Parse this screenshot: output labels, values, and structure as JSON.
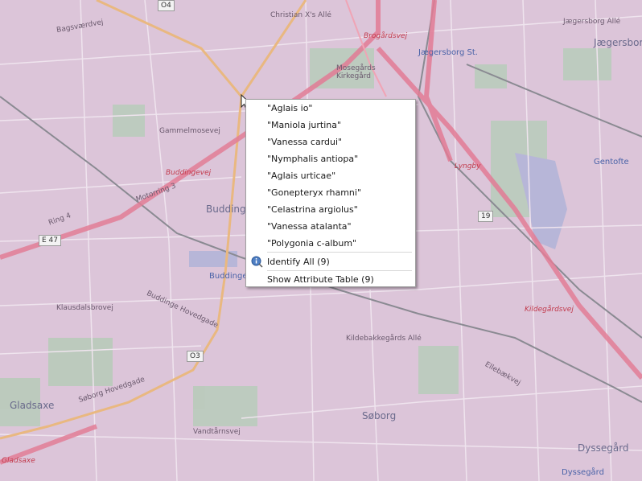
{
  "map": {
    "labels": {
      "christian": "Christian X's Allé",
      "jaegersborg_alle": "Jægersborg Allé",
      "jaegersborg": "Jægersborg",
      "brogaardsvej": "Brogårdsvej",
      "mosegaards": "Mosegårds Kirkegård",
      "jaegersborg_st": "Jægersborg St.",
      "gammelmosevej": "Gammelmosevej",
      "buddingevej": "Buddingevej",
      "motorring": "Motorring 3",
      "buddinge": "Buddinge",
      "buddinge_st": "Buddinge",
      "gentofte": "Gentofte",
      "lyngby": "Lyngby",
      "kildegaardsvej": "Kildegårdsvej",
      "soeborg": "Søborg",
      "gladsaxe": "Gladsaxe",
      "gladsaxe2": "Gladsaxe",
      "dyssegaard": "Dyssegård",
      "dyssegaard2": "Dyssegård",
      "kildebakke": "Kildebakkegårds Allé",
      "buddinge_hoved": "Buddinge Hovedgade",
      "vandtaarnsvej": "Vandtårnsvej",
      "soeborg_hoved": "Søborg Hovedgade",
      "bagsvaerdvej": "Bagsværdvej",
      "ring4": "Ring 4",
      "ellebaekvej": "Ellebækvej",
      "klausdalsbrovej": "Klausdalsbrovej"
    },
    "shields": {
      "e47": "E 47",
      "r19": "19",
      "r03": "O3",
      "r04": "O4"
    }
  },
  "context_menu": {
    "items": [
      "\"Aglais io\"",
      "\"Maniola jurtina\"",
      "\"Vanessa cardui\"",
      "\"Nymphalis antiopa\"",
      "\"Aglais urticae\"",
      "\"Gonepteryx rhamni\"",
      "\"Celastrina argiolus\"",
      "\"Vanessa atalanta\"",
      "\"Polygonia c-album\""
    ],
    "identify_all": "Identify All (9)",
    "show_attribute_table": "Show Attribute Table (9)"
  }
}
